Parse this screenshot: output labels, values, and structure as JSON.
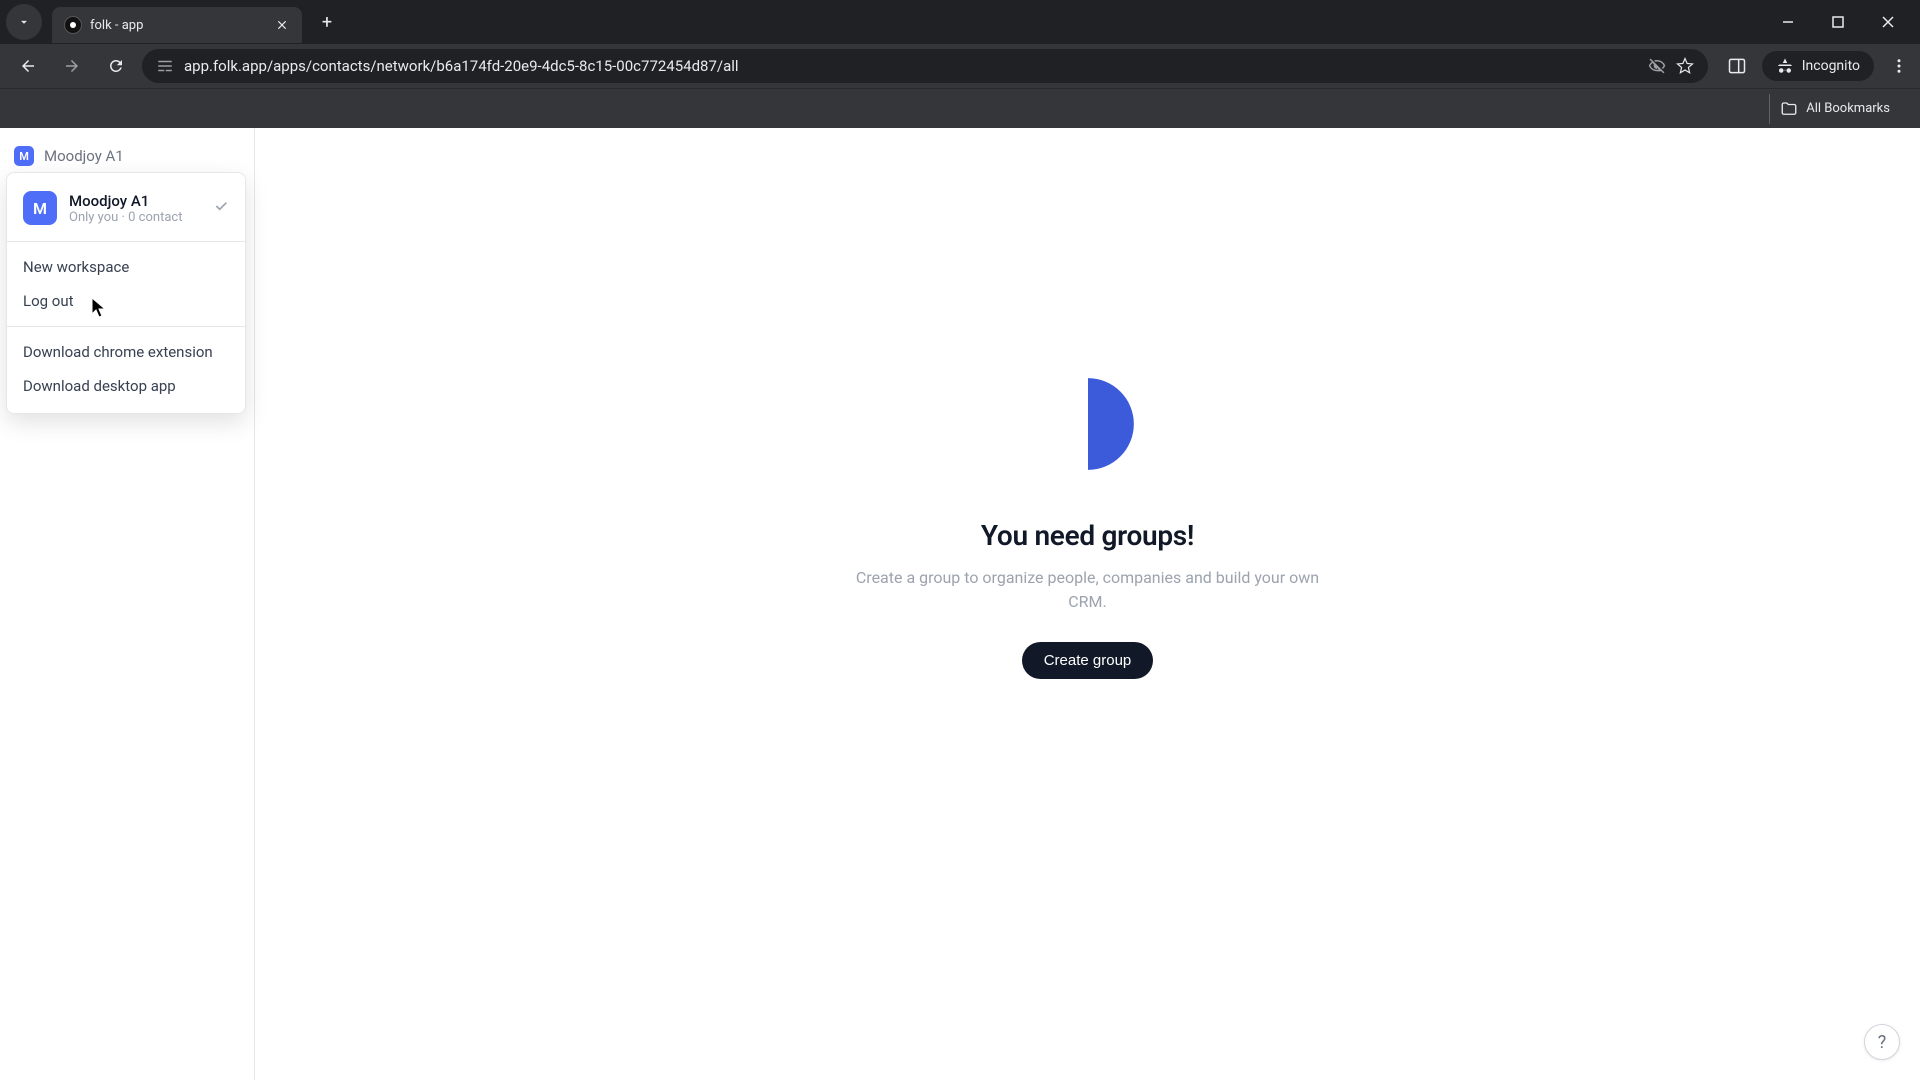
{
  "browser": {
    "tab_title": "folk - app",
    "url": "app.folk.app/apps/contacts/network/b6a174fd-20e9-4dc5-8c15-00c772454d87/all",
    "incognito_label": "Incognito",
    "all_bookmarks": "All Bookmarks"
  },
  "sidebar": {
    "workspace_name": "Moodjoy A1",
    "workspace_initial": "M"
  },
  "dropdown": {
    "current_name": "Moodjoy A1",
    "current_sub": "Only you · 0 contact",
    "new_workspace": "New workspace",
    "log_out": "Log out",
    "download_ext": "Download chrome extension",
    "download_app": "Download desktop app"
  },
  "empty": {
    "title": "You need groups!",
    "subtitle": "Create a group to organize people, companies and build your own CRM.",
    "button": "Create group"
  },
  "help": "?"
}
